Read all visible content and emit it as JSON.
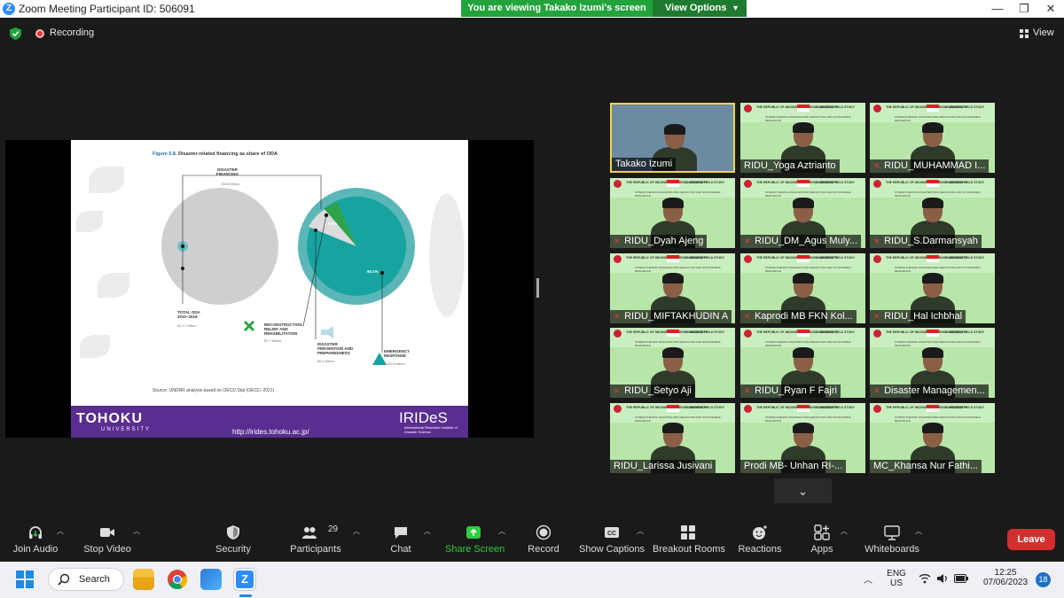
{
  "window": {
    "title": "Zoom Meeting Participant ID: 506091",
    "logo": "Z",
    "controls": [
      "—",
      "❐",
      "✕"
    ]
  },
  "banner": {
    "message": "You are viewing Takako Izumi's screen",
    "options": "View Options"
  },
  "status": {
    "recording": "Recording",
    "view": "View"
  },
  "slide": {
    "figure_number": "Figure 5.8.",
    "figure_title": "Disaster-related financing as share of ODA",
    "disaster_financing": "DISASTER\nFINANCING",
    "disaster_financing_value": "$159 billion",
    "total_oda": "TOTAL ODA\n2010–2019",
    "total_oda_value": "$1.17 trillion",
    "reconstruction": "RECONSTRUCTION,\nRELIEF AND\nREHABILITATION",
    "reconstruction_value": "$7.7 billion",
    "prevention": "DISASTER\nPREVENTION AND\nPREPAREDNESS",
    "prevention_value": "$5.5 billion",
    "emergency": "EMERGENCY\nRESPONSE",
    "emergency_value": "$129.8 billion",
    "pct_small": "5.8%",
    "pct_large": "90.1%",
    "source": "Source: UNDRR analysis based on OECD.Stat (OECD, 2021)",
    "footer_left": "TOHOKU",
    "footer_univ": "UNIVERSITY",
    "footer_url": "http://irides.tohoku.ac.jp/",
    "footer_logo": "IRIDeS",
    "footer_logo_sub": "International Research Institute of Disaster Science"
  },
  "tile_header": {
    "left": "THE REPUBLIC OF INDONESIA DEFENSE UNIVERSITY",
    "right": "OVERSEAS FIELD STUDY",
    "subtitle": "STRENGTHENING DISASTER RISK REDUCTION AND SUSTAINABLE RESILIENCE"
  },
  "participants": [
    {
      "name": "Takako Izumi",
      "muted": false
    },
    {
      "name": "RIDU_Yoga Aztrianto",
      "muted": false
    },
    {
      "name": "RIDU_MUHAMMAD I...",
      "muted": true
    },
    {
      "name": "RIDU_Dyah Ajeng",
      "muted": true
    },
    {
      "name": "RIDU_DM_Agus Muly...",
      "muted": true
    },
    {
      "name": "RIDU_S.Darmansyah",
      "muted": true
    },
    {
      "name": "RIDU_MIFTAKHUDIN A",
      "muted": true
    },
    {
      "name": "Kaprodi MB FKN Kol...",
      "muted": true
    },
    {
      "name": "RIDU_Hal Ichbhal",
      "muted": true
    },
    {
      "name": "RIDU_Setyo Aji",
      "muted": true
    },
    {
      "name": "RIDU_Ryan F Fajri",
      "muted": true
    },
    {
      "name": "Disaster Managemen...",
      "muted": true
    },
    {
      "name": "RIDU_Larissa Jusivani",
      "muted": false
    },
    {
      "name": "Prodi MB- Unhan RI-...",
      "muted": false
    },
    {
      "name": "MC_Khansa Nur Fathi...",
      "muted": false
    }
  ],
  "toolbar": {
    "join_audio": "Join Audio",
    "stop_video": "Stop Video",
    "security": "Security",
    "participants": "Participants",
    "participants_count": "29",
    "chat": "Chat",
    "share_screen": "Share Screen",
    "record": "Record",
    "show_captions": "Show Captions",
    "breakout_rooms": "Breakout Rooms",
    "reactions": "Reactions",
    "apps": "Apps",
    "whiteboards": "Whiteboards",
    "leave": "Leave"
  },
  "taskbar": {
    "search": "Search",
    "lang1": "ENG",
    "lang2": "US",
    "time": "12:25",
    "date": "07/06/2023",
    "notifications": "18"
  }
}
